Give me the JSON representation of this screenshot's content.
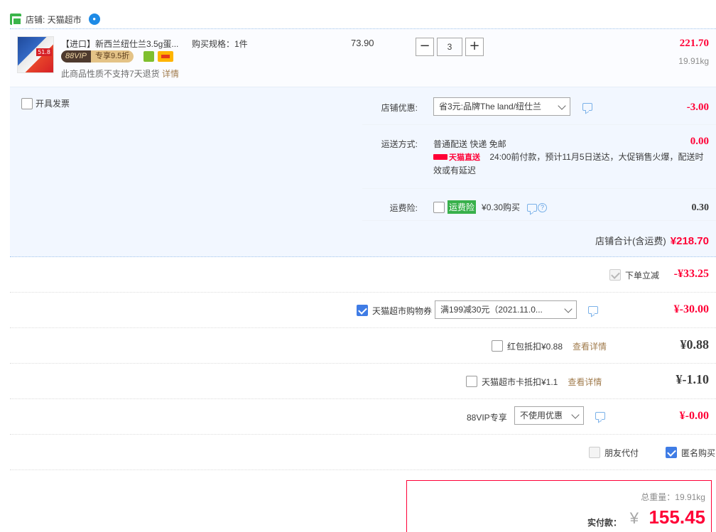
{
  "shop": {
    "label": "店铺: 天猫超市"
  },
  "item": {
    "thumb_badge": "51.8",
    "title": "【进口】新西兰纽仕兰3.5g蛋...",
    "vip_left": "88VIP",
    "vip_right": "专享9.5折",
    "no_return": "此商品性质不支持7天退货",
    "detail_link": "详情",
    "spec": "购买规格：1件",
    "unit_price": "73.90",
    "qty_minus": "−",
    "qty_value": "3",
    "qty_plus": "+",
    "line_total": "221.70",
    "line_weight": "19.91kg"
  },
  "options": {
    "invoice_label": "开具发票",
    "store_discount": {
      "label": "店铺优惠:",
      "select": "省3元:品牌The land/纽仕兰",
      "value": "-3.00"
    },
    "shipping": {
      "label": "运送方式:",
      "method": "普通配送 快递 免邮",
      "value": "0.00",
      "tmall_tag": "天猫直送",
      "note": "24:00前付款，预计11月5日送达，大促销售火爆，配送时效或有延迟"
    },
    "insurance": {
      "label": "运费险:",
      "badge": "运费险",
      "text": "¥0.30购买",
      "help": "?",
      "value": "0.30"
    },
    "shop_total": {
      "label": "店铺合计(含运费)",
      "value": "¥218.70"
    }
  },
  "summary": {
    "instant_discount": {
      "label": "下单立减",
      "value": "-¥33.25"
    },
    "coupon": {
      "label": "天猫超市购物券",
      "select": "满199减30元（2021.11.0...",
      "value": "¥-30.00"
    },
    "red_packet": {
      "label": "红包抵扣¥0.88",
      "link": "查看详情",
      "value": "¥0.88"
    },
    "card": {
      "label": "天猫超市卡抵扣¥1.1",
      "link": "查看详情",
      "value": "¥-1.10"
    },
    "vip": {
      "label": "88VIP专享",
      "select": "不使用优惠",
      "value": "¥-0.00"
    },
    "friend_pay": "朋友代付",
    "anonymous": "匿名购买"
  },
  "payment": {
    "total_weight": "总重量：19.91kg",
    "label": "实付款：",
    "yen": "¥",
    "amount": "155.45"
  },
  "colors": {
    "accent": "#ff0036",
    "link": "#a17c4e",
    "panel": "#f2f7ff",
    "check": "#3f7ce5"
  }
}
